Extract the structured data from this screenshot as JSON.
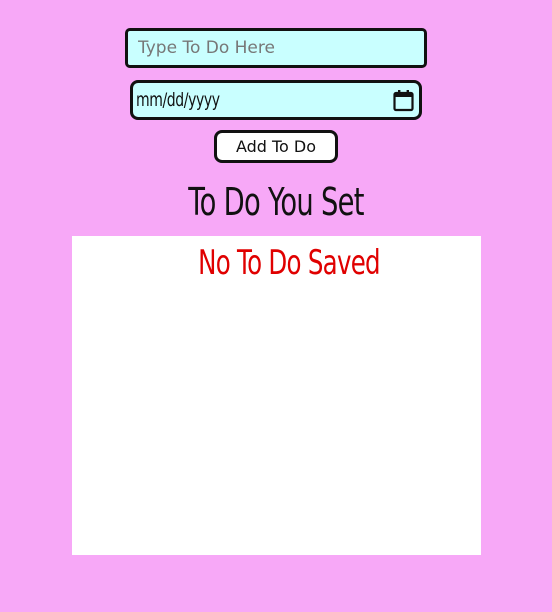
{
  "form": {
    "todo_placeholder": "Type To Do Here",
    "date_placeholder": "mm/dd/yyyy",
    "add_button_label": "Add To Do"
  },
  "list": {
    "heading": "To Do You Set",
    "empty_message": "No To Do Saved"
  },
  "icons": {
    "date_picker": "calendar-icon"
  },
  "colors": {
    "page_background": "#f7a8f7",
    "input_background": "#c9ffff",
    "panel_background": "#ffffff",
    "empty_message_color": "#e00000"
  }
}
